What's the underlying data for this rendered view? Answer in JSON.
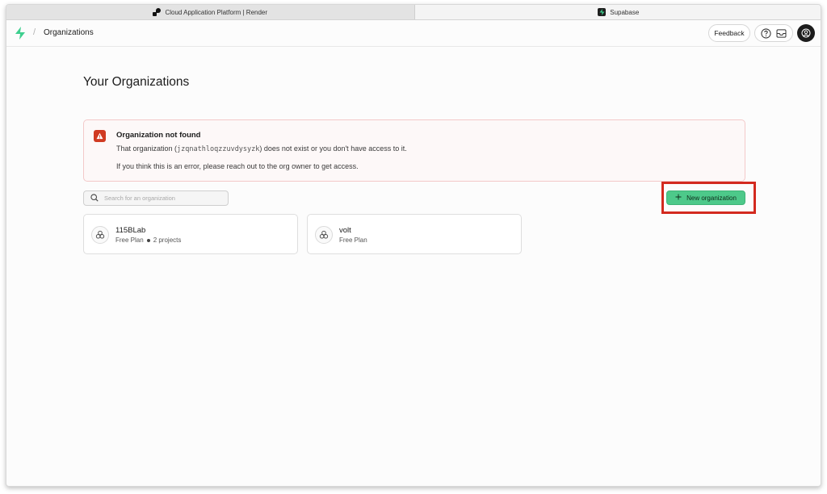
{
  "browser": {
    "tabs": [
      {
        "title": "Cloud Application Platform | Render",
        "active": false,
        "favicon": "render-logo"
      },
      {
        "title": "Supabase",
        "active": true,
        "favicon": "supabase-logo"
      }
    ]
  },
  "header": {
    "breadcrumb": "Organizations",
    "separator": "/",
    "feedback_label": "Feedback",
    "icons": [
      "help-icon",
      "inbox-icon",
      "user-avatar"
    ]
  },
  "main": {
    "title": "Your Organizations",
    "alert": {
      "title": "Organization not found",
      "line1_prefix": "That organization (",
      "org_slug": "jzqnathloqzzuvdysyzk",
      "line1_suffix": ") does not exist or you don't have access to it.",
      "line2": "If you think this is an error, please reach out to the org owner to get access."
    },
    "search": {
      "placeholder": "Search for an organization",
      "value": ""
    },
    "new_org_label": "New organization",
    "organizations": [
      {
        "name": "115BLab",
        "plan": "Free Plan",
        "projects": "2 projects"
      },
      {
        "name": "volt",
        "plan": "Free Plan",
        "projects": ""
      }
    ]
  },
  "colors": {
    "accent": "#4dc98a",
    "alert_red": "#d03a22",
    "highlight_box": "#d32a1f"
  }
}
